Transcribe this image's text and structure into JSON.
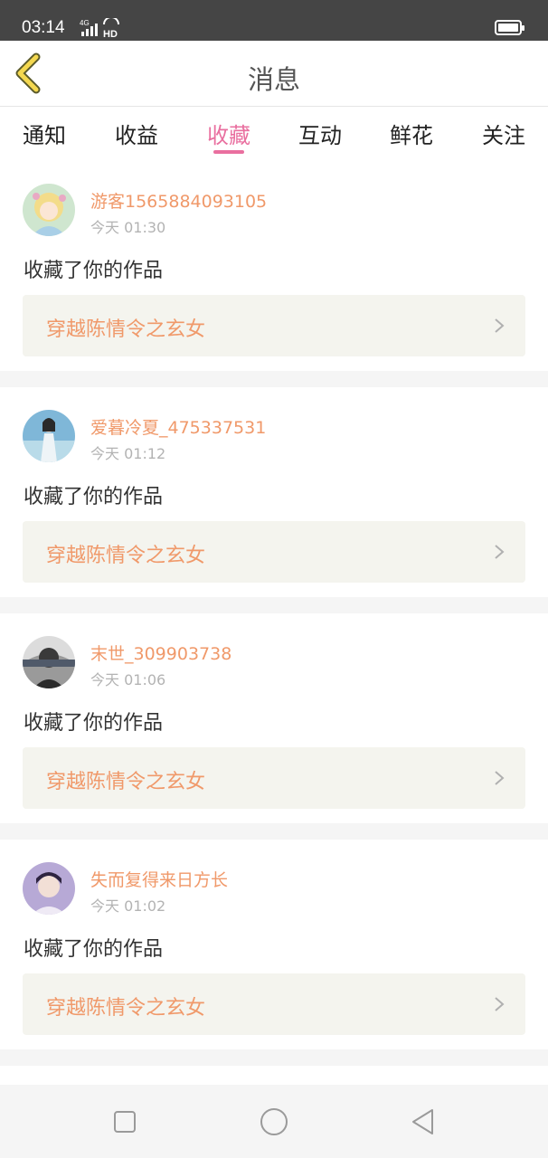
{
  "status_bar": {
    "time": "03:14",
    "network": "4G",
    "hd": "HD"
  },
  "header": {
    "title": "消息"
  },
  "tabs": [
    {
      "label": "通知"
    },
    {
      "label": "收益"
    },
    {
      "label": "收藏"
    },
    {
      "label": "互动"
    },
    {
      "label": "鲜花"
    },
    {
      "label": "关注"
    }
  ],
  "active_tab": "收藏",
  "feed": [
    {
      "user": "游客1565884093105",
      "time": "今天 01:30",
      "action": "收藏了你的作品",
      "work": "穿越陈情令之玄女"
    },
    {
      "user": "爱暮冷夏_475337531",
      "time": "今天 01:12",
      "action": "收藏了你的作品",
      "work": "穿越陈情令之玄女"
    },
    {
      "user": "末世_309903738",
      "time": "今天 01:06",
      "action": "收藏了你的作品",
      "work": "穿越陈情令之玄女"
    },
    {
      "user": "失而复得来日方长",
      "time": "今天 01:02",
      "action": "收藏了你的作品",
      "work": "穿越陈情令之玄女"
    }
  ],
  "colors": {
    "accent": "#e96f9f",
    "name": "#f0996a",
    "status_bar": "#454545"
  }
}
